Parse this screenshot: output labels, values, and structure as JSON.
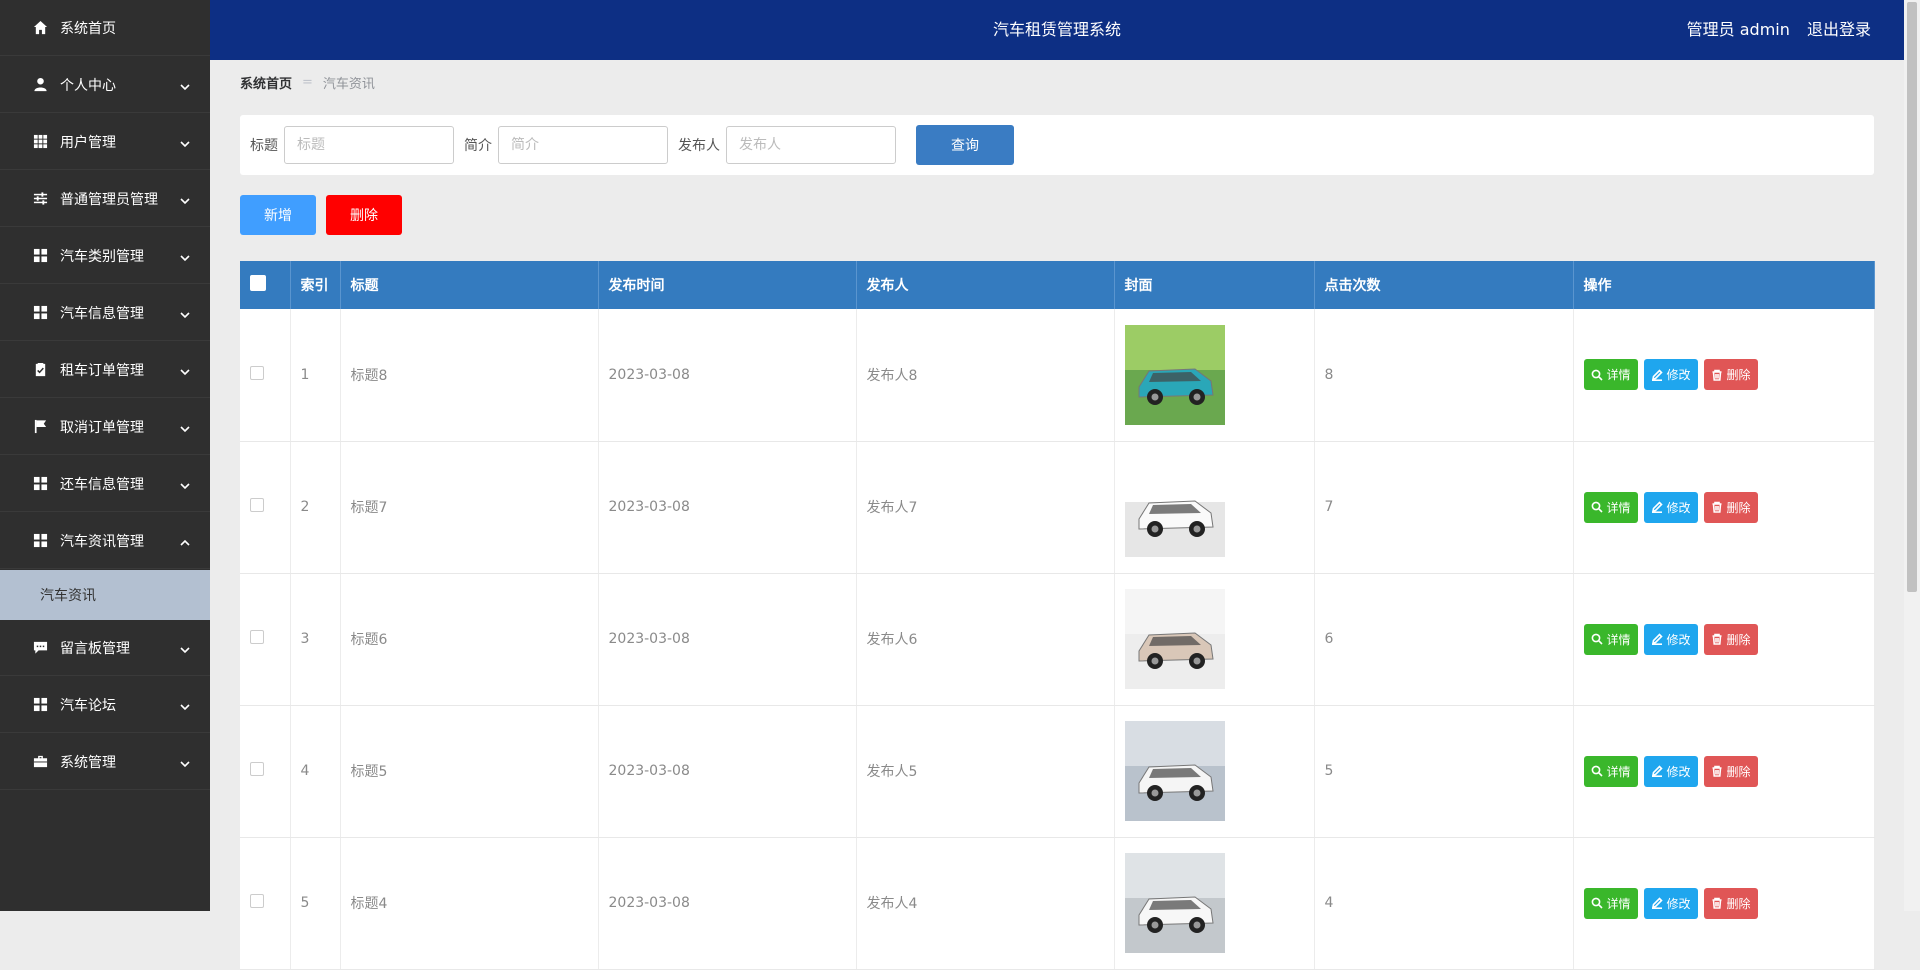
{
  "header": {
    "title": "汽车租赁管理系统",
    "user_label": "管理员 admin",
    "logout": "退出登录"
  },
  "sidebar": {
    "items": [
      {
        "label": "系统首页",
        "icon": "home-icon",
        "expandable": false
      },
      {
        "label": "个人中心",
        "icon": "user-icon",
        "expandable": true
      },
      {
        "label": "用户管理",
        "icon": "grid-icon",
        "expandable": true
      },
      {
        "label": "普通管理员管理",
        "icon": "sliders-icon",
        "expandable": true
      },
      {
        "label": "汽车类别管理",
        "icon": "apps-icon",
        "expandable": true
      },
      {
        "label": "汽车信息管理",
        "icon": "apps-icon",
        "expandable": true
      },
      {
        "label": "租车订单管理",
        "icon": "clipboard-icon",
        "expandable": true
      },
      {
        "label": "取消订单管理",
        "icon": "flag-icon",
        "expandable": true
      },
      {
        "label": "还车信息管理",
        "icon": "apps-icon",
        "expandable": true
      },
      {
        "label": "汽车资讯管理",
        "icon": "apps-icon",
        "expandable": true,
        "expanded": true
      }
    ],
    "submenu": {
      "label": "汽车资讯"
    },
    "items_after": [
      {
        "label": "留言板管理",
        "icon": "chat-icon",
        "expandable": true
      },
      {
        "label": "汽车论坛",
        "icon": "apps-icon",
        "expandable": true
      },
      {
        "label": "系统管理",
        "icon": "briefcase-icon",
        "expandable": true
      }
    ]
  },
  "breadcrumb": {
    "home": "系统首页",
    "separator": "=",
    "current": "汽车资讯"
  },
  "search": {
    "title_label": "标题",
    "title_placeholder": "标题",
    "intro_label": "简介",
    "intro_placeholder": "简介",
    "publisher_label": "发布人",
    "publisher_placeholder": "发布人",
    "query_button": "查询"
  },
  "actions": {
    "add": "新增",
    "delete": "删除"
  },
  "table": {
    "headers": [
      "索引",
      "标题",
      "发布时间",
      "发布人",
      "封面",
      "点击次数",
      "操作"
    ],
    "op_labels": {
      "detail": "详情",
      "edit": "修改",
      "remove": "删除"
    },
    "rows": [
      {
        "index": "1",
        "title": "标题8",
        "date": "2023-03-08",
        "publisher": "发布人8",
        "clicks": "8",
        "cover": "blue sports car drifting on grass"
      },
      {
        "index": "2",
        "title": "标题7",
        "date": "2023-03-08",
        "publisher": "发布人7",
        "clicks": "7",
        "cover": "white SUV"
      },
      {
        "index": "3",
        "title": "标题6",
        "date": "2023-03-08",
        "publisher": "发布人6",
        "clicks": "6",
        "cover": "beige compact car"
      },
      {
        "index": "4",
        "title": "标题5",
        "date": "2023-03-08",
        "publisher": "发布人5",
        "clicks": "5",
        "cover": "white SUV in showroom"
      },
      {
        "index": "5",
        "title": "标题4",
        "date": "2023-03-08",
        "publisher": "发布人4",
        "clicks": "4",
        "cover": "white car in showroom"
      }
    ]
  },
  "colors": {
    "sidebar_bg": "#2f2f2f",
    "header_bg": "#0d2f84",
    "table_header": "#347bbf",
    "submenu_active": "#b3c0d1",
    "add_btn": "#409eff",
    "delete_btn": "#ff0000",
    "detail_btn": "#3ab72b",
    "edit_btn": "#1fa6ee",
    "remove_btn": "#e05656"
  }
}
